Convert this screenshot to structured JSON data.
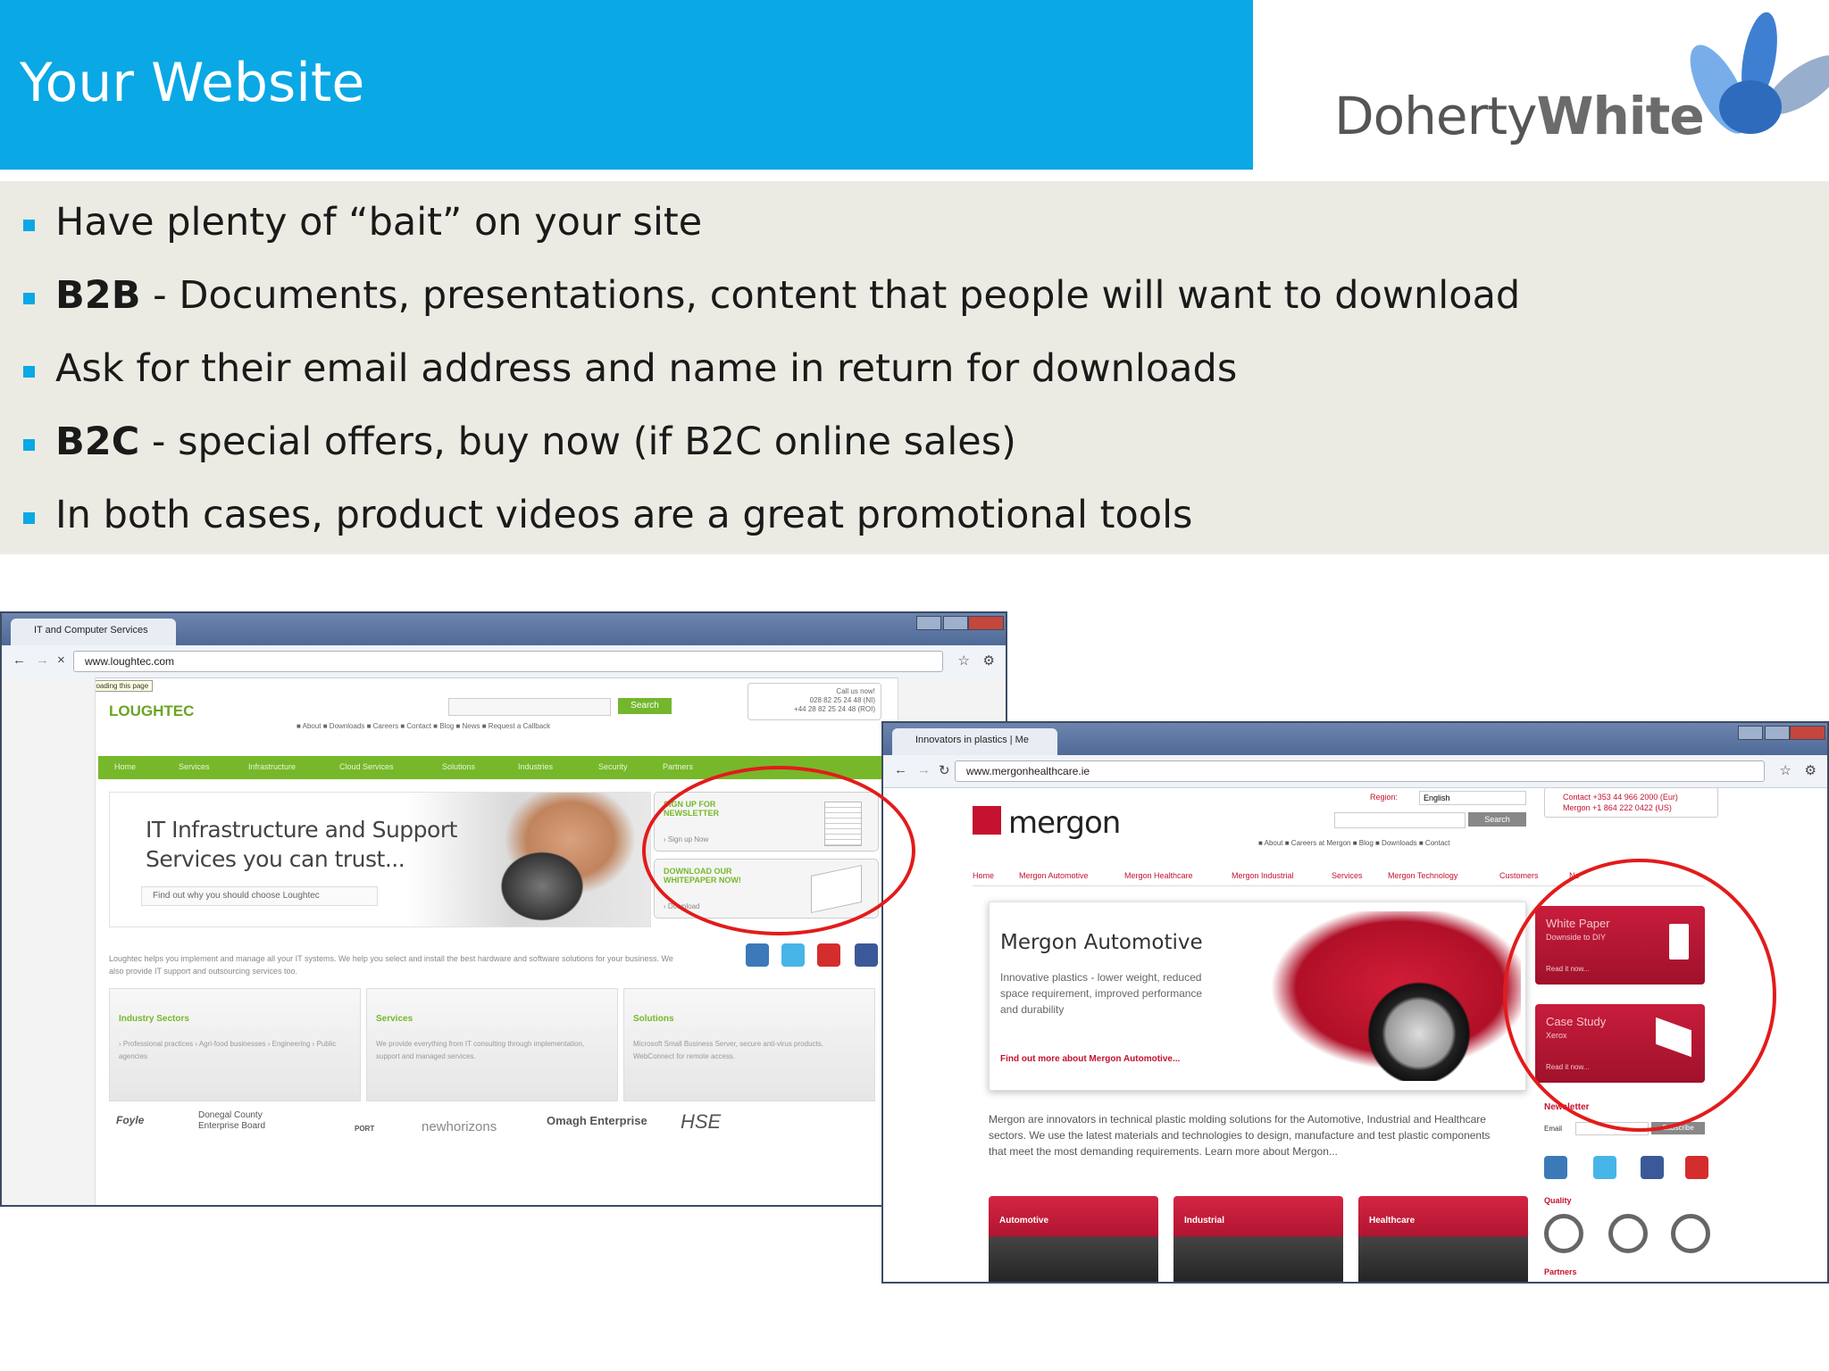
{
  "slide": {
    "title": "Your Website",
    "logo_text_regular": "Doherty",
    "logo_text_bold": "White"
  },
  "bullets": [
    {
      "bold": "",
      "text": "Have plenty of “bait” on your site"
    },
    {
      "bold": "B2B",
      "text": " - Documents, presentations, content  that people will want to download"
    },
    {
      "bold": "",
      "text": "Ask for their email address and name in return for downloads"
    },
    {
      "bold": "B2C",
      "text": " - special offers, buy now (if B2C online sales)"
    },
    {
      "bold": "",
      "text": "In both cases, product videos are a great promotional tools"
    }
  ],
  "colors": {
    "title_bar": "#0aa8e5",
    "bullet_band": "#ecebe3",
    "highlight_circle": "#e31b1b",
    "loughtec_green": "#76b82a",
    "mergon_red": "#c41230"
  },
  "loughtec": {
    "tab_title": "IT and Computer Services",
    "url": "www.loughtec.com",
    "tooltip": "Stop loading this page",
    "brand": "LOUGHTEC",
    "search_button": "Search",
    "call_box": [
      "Call us now!",
      "028 82 25 24 48 (NI)",
      "+44 28 82 25 24 48 (ROI)"
    ],
    "links": "■ About  ■ Downloads  ■ Careers  ■ Contact  ■ Blog  ■ News  ■ Request a Callback",
    "nav": [
      "Home",
      "Services",
      "Infrastructure",
      "Cloud Services",
      "Solutions",
      "Industries",
      "Security",
      "Partners"
    ],
    "hero_line1": "IT Infrastructure and Support",
    "hero_line2": "Services you can trust...",
    "hero_link": "Find out why you should choose Loughtec",
    "signup_title_1": "SIGN UP FOR",
    "signup_title_2": "NEWSLETTER",
    "signup_link": "› Sign up Now",
    "download_title_1": "DOWNLOAD OUR",
    "download_title_2": "WHITEPAPER NOW!",
    "download_link": "› Download",
    "intro": "Loughtec helps you implement and manage all your IT systems. We help you select and install the best hardware and software solutions for your business. We also provide IT support and outsourcing services too.",
    "cards": [
      {
        "title": "Industry Sectors",
        "text": "› Professional practices › Agri-food businesses › Engineering › Public agencies"
      },
      {
        "title": "Services",
        "text": "We provide everything from IT consulting through implementation, support and managed services."
      },
      {
        "title": "Solutions",
        "text": "Microsoft Small Business Server, secure anti-virus products, WebConnect for remote access."
      }
    ],
    "partner_logos": [
      "Foyle",
      "Donegal County Enterprise Board",
      "PORT",
      "newhorizons",
      "Omagh Enterprise",
      "HSE"
    ]
  },
  "mergon": {
    "tab_title": "Innovators in plastics | Me",
    "url": "www.mergonhealthcare.ie",
    "brand": "mergon",
    "region_label": "Region:",
    "region_value": "English",
    "search_button": "Search",
    "contact_1": "Contact  +353 44 966 2000 (Eur)",
    "contact_2": "Mergon  +1 864 222 0422  (US)",
    "links": "■ About  ■ Careers at Mergon  ■ Blog  ■ Downloads  ■ Contact",
    "nav": [
      "Home",
      "Mergon Automotive",
      "Mergon Healthcare",
      "Mergon Industrial",
      "Services",
      "Mergon Technology",
      "Customers",
      "Ne"
    ],
    "hero_title": "Mergon Automotive",
    "hero_text": "Innovative plastics - lower weight, reduced space requirement, improved performance and durability",
    "hero_link": "Find out more about Mergon Automotive...",
    "side_boxes": [
      {
        "title": "White Paper",
        "sub": "Downside to DIY",
        "read": "Read it now..."
      },
      {
        "title": "Case Study",
        "sub": "Xerox",
        "read": "Read it now..."
      }
    ],
    "intro": "Mergon are innovators in technical plastic molding solutions for the Automotive, Industrial and Healthcare sectors. We use the latest materials and technologies to design, manufacture and test plastic components that meet the most demanding requirements. Learn more about Mergon...",
    "newsletter": "Newsletter",
    "email_label": "Email",
    "subscribe": "Subscribe",
    "quality": "Quality",
    "partners": "Partners",
    "cards": [
      "Automotive",
      "Industrial",
      "Healthcare"
    ]
  }
}
